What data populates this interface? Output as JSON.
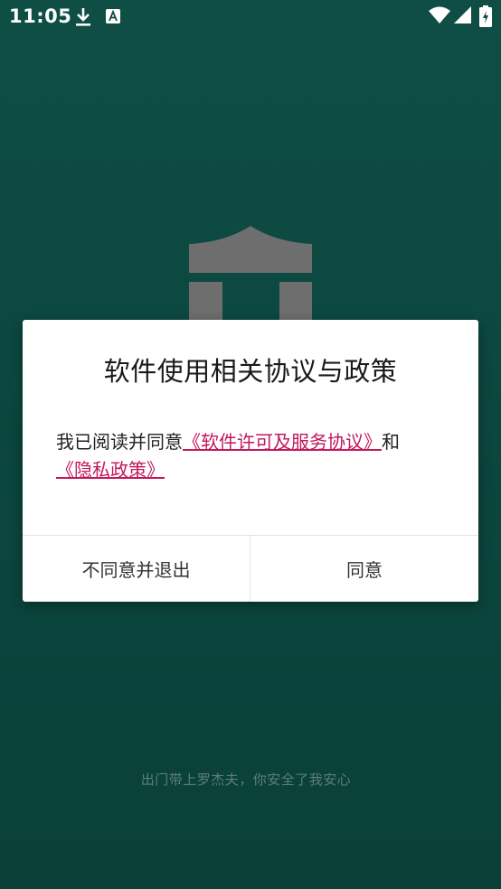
{
  "status_bar": {
    "time": "11:05",
    "icons": [
      "download-icon",
      "a-icon",
      "wifi-icon",
      "signal-icon",
      "battery-icon"
    ]
  },
  "dialog": {
    "title": "软件使用相关协议与政策",
    "message_prefix": "我已阅读并同意",
    "link_license": "《软件许可及服务协议》",
    "connector": "和",
    "link_privacy": "《隐私政策》",
    "decline_label": "不同意并退出",
    "accept_label": "同意"
  },
  "slogan": "出门带上罗杰夫，你安全了我安心",
  "colors": {
    "background": "#0d4a42",
    "link": "#c2185b",
    "logo": "#6e6e6e"
  }
}
